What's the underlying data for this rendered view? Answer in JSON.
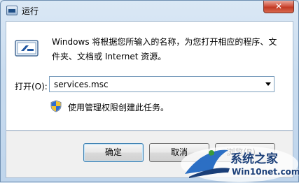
{
  "window": {
    "title": "运行",
    "close_glyph": "✕"
  },
  "main": {
    "description": "Windows 将根据您所输入的名称，为您打开相应的程序、文件夹、文档或 Internet 资源。",
    "open_label": "打开(O):",
    "open_value": "services.msc",
    "admin_note": "使用管理权限创建此任务。"
  },
  "buttons": {
    "ok_label": "确定",
    "cancel_label": "取消",
    "browse_label": "浏览(B)..."
  },
  "watermark": {
    "site_name": "系统之家",
    "site_url": "Win10net.com"
  },
  "icons": {
    "app": "run-dialog-icon",
    "main": "run-program-icon",
    "shield": "uac-shield-icon",
    "close": "close-icon",
    "dropdown": "chevron-down-icon"
  }
}
